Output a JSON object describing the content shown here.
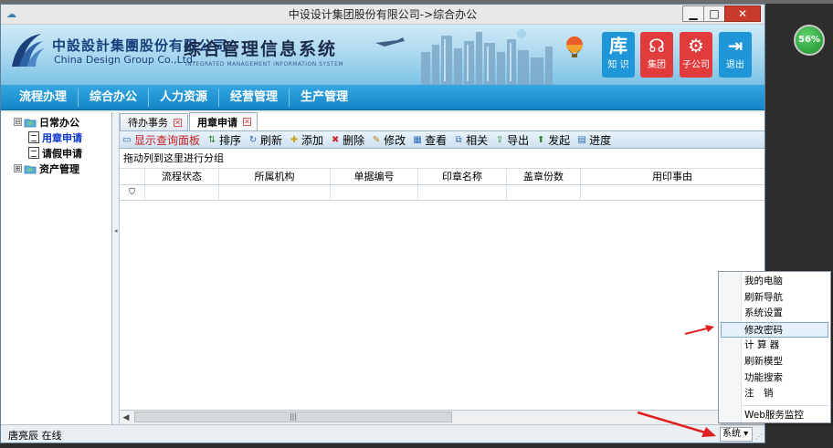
{
  "window": {
    "title": "中设设计集团股份有限公司->综合办公",
    "buttons": {
      "minimize": "▁",
      "maximize": "□",
      "close": "✕"
    }
  },
  "banner": {
    "company_cn": "中設設計集團股份有限公司",
    "company_en": "China Design Group Co.,Ltd.",
    "system_cn": "综合管理信息系统",
    "system_en": "INTEGRATED MANAGEMENT INFORMATION SYSTEM",
    "quick_buttons": [
      {
        "glyph": "库",
        "label": "知 识",
        "color": "#1e96d8",
        "icon": "library-icon"
      },
      {
        "glyph": "☊",
        "label": "集团",
        "color": "#e23b3b",
        "icon": "rss-icon"
      },
      {
        "glyph": "⚙",
        "label": "子公司",
        "color": "#e23b3b",
        "icon": "gear-icon"
      },
      {
        "glyph": "⇥",
        "label": "退出",
        "color": "#1e96d8",
        "icon": "exit-icon"
      }
    ]
  },
  "nav": [
    "流程办理",
    "综合办公",
    "人力资源",
    "经营管理",
    "生产管理"
  ],
  "tree": [
    {
      "label": "日常办公",
      "expander": "⊟",
      "level": 0,
      "selected": false
    },
    {
      "label": "用章申请",
      "level": 1,
      "selected": true
    },
    {
      "label": "请假申请",
      "level": 1,
      "selected": false
    },
    {
      "label": "资产管理",
      "expander": "⊞",
      "level": 0,
      "selected": false
    }
  ],
  "tabs": [
    {
      "label": "待办事务",
      "active": false
    },
    {
      "label": "用章申请",
      "active": true
    }
  ],
  "toolbar": [
    {
      "label": "显示查询面板",
      "icon": "monitor-icon",
      "glyph": "▭",
      "red": true
    },
    {
      "label": "排序",
      "icon": "sort-icon",
      "glyph": "⇅",
      "red": false
    },
    {
      "label": "刷新",
      "icon": "refresh-icon",
      "glyph": "↻",
      "red": false
    },
    {
      "label": "添加",
      "icon": "add-icon",
      "glyph": "✚",
      "red": false
    },
    {
      "label": "删除",
      "icon": "delete-icon",
      "glyph": "✖",
      "red": false
    },
    {
      "label": "修改",
      "icon": "edit-icon",
      "glyph": "✎",
      "red": false
    },
    {
      "label": "查看",
      "icon": "view-icon",
      "glyph": "▦",
      "red": false
    },
    {
      "label": "相关",
      "icon": "related-icon",
      "glyph": "⧉",
      "red": false
    },
    {
      "label": "导出",
      "icon": "export-icon",
      "glyph": "⇪",
      "red": false
    },
    {
      "label": "发起",
      "icon": "launch-icon",
      "glyph": "⬆",
      "red": false
    },
    {
      "label": "进度",
      "icon": "progress-icon",
      "glyph": "▤",
      "red": false
    }
  ],
  "group_hint": "拖动列到这里进行分组",
  "columns": [
    "流程状态",
    "所属机构",
    "单据编号",
    "印章名称",
    "盖章份数",
    "用印事由"
  ],
  "status": {
    "user": "唐亮辰 在线",
    "system_button": "系统"
  },
  "menu": {
    "items": [
      "我的电脑",
      "刷新导航",
      "系统设置",
      "修改密码",
      "计 算 器",
      "刷新模型",
      "功能搜索",
      "注　销"
    ],
    "highlighted_index": 3,
    "footer": "Web服务监控"
  },
  "badge": {
    "percent": "56%"
  },
  "colors": {
    "nav": "#1e8fd2",
    "accent_red": "#e03030",
    "selected_tree": "#0b37c8"
  }
}
